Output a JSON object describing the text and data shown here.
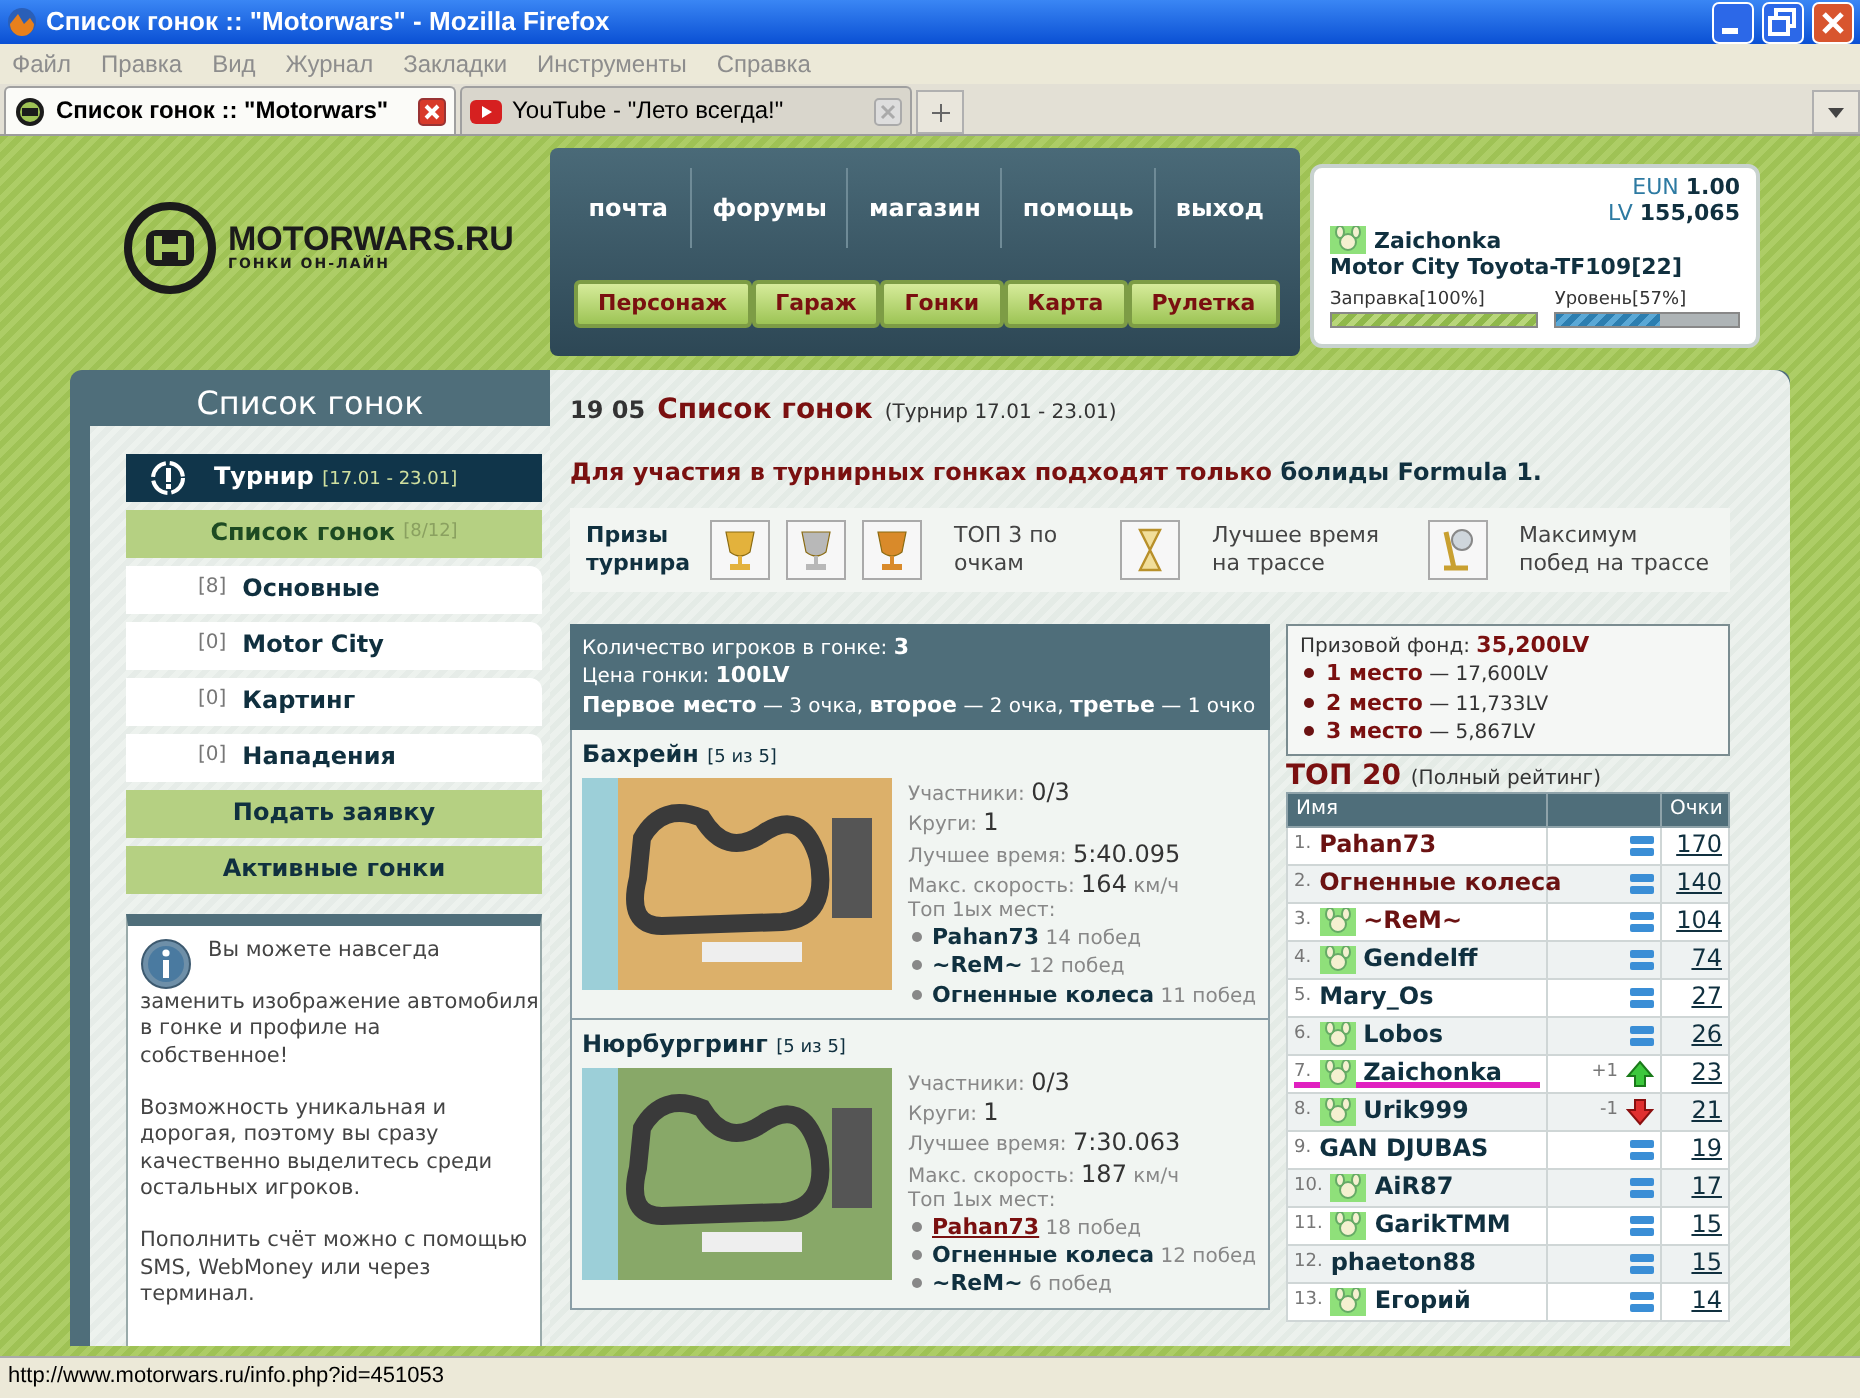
{
  "window": {
    "title": "Список гонок :: \"Motorwars\" - Mozilla Firefox"
  },
  "menu": [
    "Файл",
    "Правка",
    "Вид",
    "Журнал",
    "Закладки",
    "Инструменты",
    "Справка"
  ],
  "tabs": [
    {
      "label": "Список гонок :: \"Motorwars\"",
      "selected": true
    },
    {
      "label": "YouTube - \"Лето всегда!\"",
      "selected": false
    }
  ],
  "header": {
    "logo": "MOTORWARS.RU",
    "tagline": "ГОНКИ ОН-ЛАЙН",
    "top_links": [
      "почта",
      "форумы",
      "магазин",
      "помощь",
      "выход"
    ],
    "buttons": [
      "Персонаж",
      "Гараж",
      "Гонки",
      "Карта",
      "Рулетка"
    ]
  },
  "user": {
    "balances": [
      {
        "code": "EUN",
        "amount": "1.00"
      },
      {
        "code": "LV",
        "amount": "155,065"
      }
    ],
    "name": "Zaichonka",
    "car": "Motor City Toyota-TF109[22]",
    "meters": [
      {
        "label": "Заправка[100%]",
        "kind": "fuel",
        "level": 1.0
      },
      {
        "label": "Уровень[57%]",
        "kind": "xp",
        "level": 0.57
      }
    ]
  },
  "sidebar": {
    "title": "Список гонок",
    "tournament": {
      "label": "Турнир",
      "dates": "[17.01 - 23.01]"
    },
    "list_header": {
      "label": "Список гонок",
      "count": "[8/12]"
    },
    "categories": [
      {
        "count": "[8]",
        "label": "Основные"
      },
      {
        "count": "[0]",
        "label": "Motor City"
      },
      {
        "count": "[0]",
        "label": "Картинг"
      },
      {
        "count": "[0]",
        "label": "Нападения"
      }
    ],
    "actions": [
      "Подать заявку",
      "Активные гонки"
    ],
    "info": [
      [
        {
          "kind": "text",
          "text": "Вы можете навсегда "
        },
        {
          "kind": "link",
          "text": "заменить изображение автомобиля"
        },
        {
          "kind": "text",
          "text": " в гонке и профиле на собственное!"
        }
      ],
      [
        {
          "kind": "text",
          "text": "Возможность уникальная и дорогая, поэтому вы сразу качественно выделитесь среди остальных игроков."
        }
      ],
      [
        {
          "kind": "link",
          "text": "Пополнить счёт"
        },
        {
          "kind": "text",
          "text": " можно с помощью SMS, WebMoney или через терминал."
        }
      ]
    ]
  },
  "heading": {
    "number": "19 05",
    "title": "Список гонок",
    "note": "(Турнир 17.01 - 23.01)"
  },
  "notice": {
    "text": "Для участия в турнирных гонках подходят только",
    "highlight": "болиды Formula 1."
  },
  "prizes": {
    "label": "Призы турнира",
    "groups": [
      {
        "kind": "podium",
        "text": "ТОП 3 по очкам"
      },
      {
        "kind": "hourglass",
        "text": "Лучшее время на трассе"
      },
      {
        "kind": "cup",
        "text": "Максимум побед на трассе"
      }
    ]
  },
  "race_info": [
    "Количество игроков в гонке: **3**",
    "Цена гонки: **100LV**",
    "**Первое место** — 3 очка, **второе** — 2 очка, **третье** — 1 очко"
  ],
  "tracks": [
    {
      "name": "Бахрейн",
      "count": "[5 из 5]",
      "stats": [
        {
          "label": "Участники:",
          "value": "0/3"
        },
        {
          "label": "Круги:",
          "value": "1"
        },
        {
          "label": "Лучшее время:",
          "value": "5:40.095"
        },
        {
          "label": "Макс. скорость:",
          "value": "164",
          "unit": "км/ч"
        }
      ],
      "top_label": "Топ 1ых мест:",
      "top": [
        {
          "name": "Pahan73",
          "wins": "14 побед",
          "highlighted": false
        },
        {
          "name": "~ReM~",
          "wins": "12 побед",
          "highlighted": false
        },
        {
          "name": "Огненные колеса",
          "wins": "11 побед",
          "highlighted": false
        }
      ]
    },
    {
      "name": "Нюрбургринг",
      "count": "[5 из 5]",
      "stats": [
        {
          "label": "Участники:",
          "value": "0/3"
        },
        {
          "label": "Круги:",
          "value": "1"
        },
        {
          "label": "Лучшее время:",
          "value": "7:30.063"
        },
        {
          "label": "Макс. скорость:",
          "value": "187",
          "unit": "км/ч"
        }
      ],
      "top_label": "Топ 1ых мест:",
      "top": [
        {
          "name": "Pahan73",
          "wins": "18 побед",
          "highlighted": true
        },
        {
          "name": "Огненные колеса",
          "wins": "12 побед",
          "highlighted": false
        },
        {
          "name": "~ReM~",
          "wins": "6 побед",
          "highlighted": false
        }
      ]
    }
  ],
  "prize_fund": {
    "label": "Призовой фонд:",
    "total": "35,200LV",
    "places": [
      {
        "place": "1 место",
        "amount": "— 17,600LV"
      },
      {
        "place": "2 место",
        "amount": "— 11,733LV"
      },
      {
        "place": "3 место",
        "amount": "— 5,867LV"
      }
    ]
  },
  "ranking": {
    "title": "ТОП 20",
    "subtitle": "(Полный рейтинг)",
    "columns": [
      "Имя",
      "Очки"
    ],
    "rows": [
      {
        "rank": "1.",
        "name": "Pahan73",
        "avatar": false,
        "leader": true,
        "kind": "list",
        "points": "170",
        "current": false
      },
      {
        "rank": "2.",
        "name": "Огненные колеса",
        "avatar": false,
        "leader": true,
        "kind": "list",
        "points": "140",
        "current": false
      },
      {
        "rank": "3.",
        "name": "~ReM~",
        "avatar": true,
        "leader": true,
        "kind": "list",
        "points": "104",
        "current": false
      },
      {
        "rank": "4.",
        "name": "Gendelff",
        "avatar": true,
        "leader": false,
        "kind": "list",
        "points": "74",
        "current": false
      },
      {
        "rank": "5.",
        "name": "Mary_Os",
        "avatar": false,
        "leader": false,
        "kind": "list",
        "points": "27",
        "current": false
      },
      {
        "rank": "6.",
        "name": "Lobos",
        "avatar": true,
        "leader": false,
        "kind": "list",
        "points": "26",
        "current": false
      },
      {
        "rank": "7.",
        "name": "Zaichonka",
        "avatar": true,
        "leader": false,
        "kind": "up",
        "change": "+1",
        "points": "23",
        "current": true
      },
      {
        "rank": "8.",
        "name": "Urik999",
        "avatar": true,
        "leader": false,
        "kind": "down",
        "change": "-1",
        "points": "21",
        "current": false
      },
      {
        "rank": "9.",
        "name": "GAN DJUBAS",
        "avatar": false,
        "leader": false,
        "kind": "list",
        "points": "19",
        "current": false
      },
      {
        "rank": "10.",
        "name": "AiR87",
        "avatar": true,
        "leader": false,
        "kind": "list",
        "points": "17",
        "current": false
      },
      {
        "rank": "11.",
        "name": "GarikTMM",
        "avatar": true,
        "leader": false,
        "kind": "list",
        "points": "15",
        "current": false
      },
      {
        "rank": "12.",
        "name": "phaeton88",
        "avatar": false,
        "leader": false,
        "kind": "list",
        "points": "15",
        "current": false
      },
      {
        "rank": "13.",
        "name": "Егорий",
        "avatar": true,
        "leader": false,
        "kind": "list",
        "points": "14",
        "current": false
      }
    ]
  },
  "status_bar": "http://www.motorwars.ru/info.php?id=451053"
}
